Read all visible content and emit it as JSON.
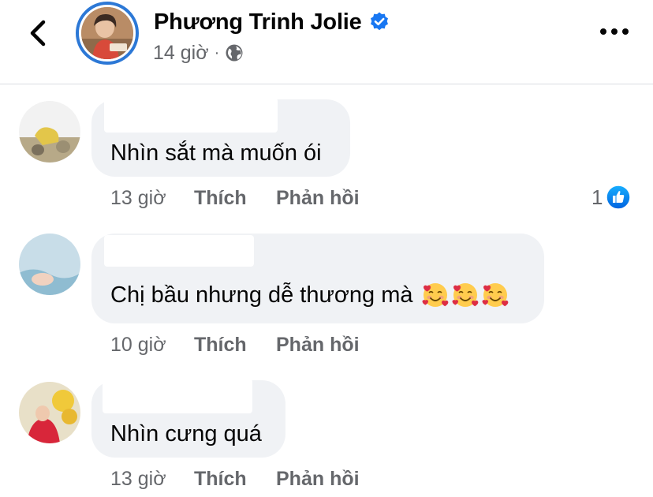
{
  "header": {
    "page_name": "Phương Trinh Jolie",
    "time": "14 giờ",
    "separator": "·",
    "icons": {
      "back": "back-chevron-icon",
      "verified": "verified-badge-icon",
      "audience": "globe-icon",
      "more": "more-dots-icon"
    },
    "verified_color": "#1877f2"
  },
  "comments": [
    {
      "text": "Nhìn sắt mà muốn ói",
      "time": "13 giờ",
      "like_label": "Thích",
      "reply_label": "Phản hồi",
      "reaction_count": "1",
      "reaction_icon": "like-reaction-icon"
    },
    {
      "text": "Chị bầu nhưng dễ thương mà",
      "emoji": [
        "smiling-face-with-hearts-icon",
        "smiling-face-with-hearts-icon",
        "smiling-face-with-hearts-icon"
      ],
      "time": "10 giờ",
      "like_label": "Thích",
      "reply_label": "Phản hồi"
    },
    {
      "text": "Nhìn cưng quá",
      "time": "13 giờ",
      "like_label": "Thích",
      "reply_label": "Phản hồi"
    }
  ],
  "colors": {
    "bubble": "#f0f2f5",
    "meta_text": "#65676b",
    "text": "#050505",
    "accent": "#1877f2"
  }
}
